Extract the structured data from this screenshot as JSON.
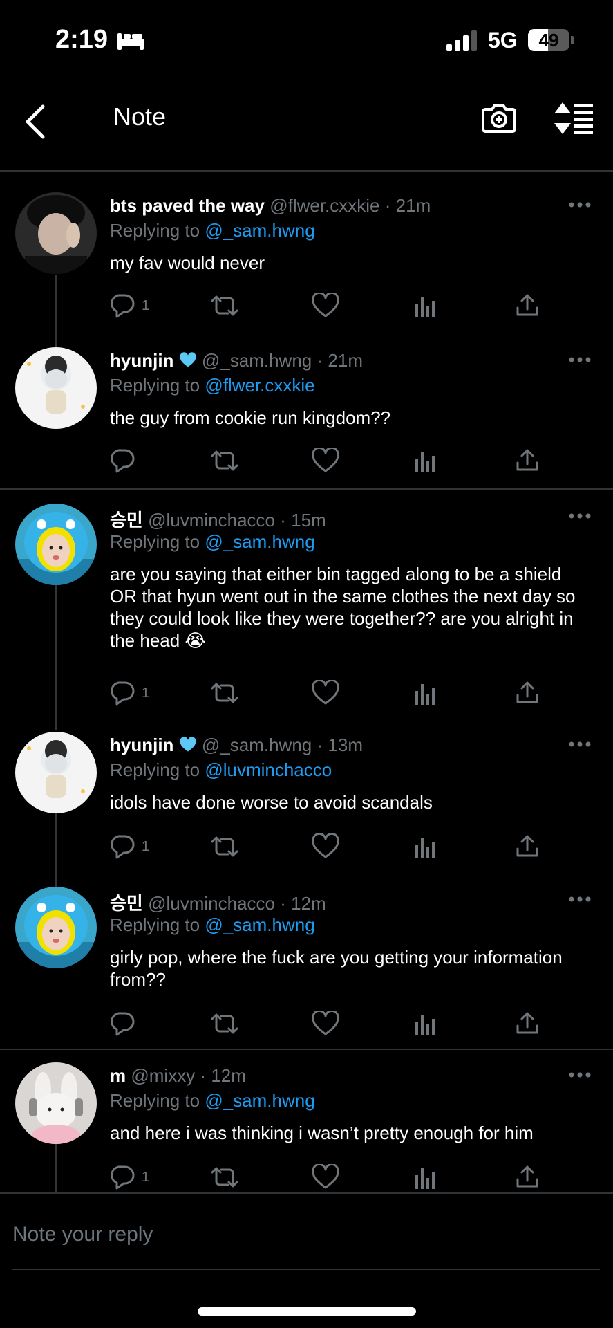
{
  "status": {
    "time": "2:19",
    "network": "5G",
    "battery": "49",
    "battery_fraction": 0.49
  },
  "nav": {
    "title": "Note"
  },
  "tweets": [
    {
      "name": "bts paved the way",
      "badge": "",
      "handle": "@flwer.cxxkie",
      "time": "21m",
      "replying_label": "Replying to",
      "replying_to": "@_sam.hwng",
      "text": "my fav would never",
      "reply_count": "1"
    },
    {
      "name": "hyunjin",
      "badge": "blue-heart",
      "handle": "@_sam.hwng",
      "time": "21m",
      "replying_label": "Replying to",
      "replying_to": "@flwer.cxxkie",
      "text": "the guy from cookie run kingdom??",
      "reply_count": ""
    },
    {
      "name": "승민",
      "badge": "",
      "handle": "@luvminchacco",
      "time": "15m",
      "replying_label": "Replying to",
      "replying_to": "@_sam.hwng",
      "text": "are you saying that either bin tagged along to be a shield OR that hyun went out in the same clothes the next day so they could look like they were together?? are you alright in the head 😭",
      "reply_count": "1"
    },
    {
      "name": "hyunjin",
      "badge": "blue-heart",
      "handle": "@_sam.hwng",
      "time": "13m",
      "replying_label": "Replying to",
      "replying_to": "@luvminchacco",
      "text": "idols have done worse to avoid scandals",
      "reply_count": "1"
    },
    {
      "name": "승민",
      "badge": "",
      "handle": "@luvminchacco",
      "time": "12m",
      "replying_label": "Replying to",
      "replying_to": "@_sam.hwng",
      "text": "girly pop, where the fuck are you getting your information from??",
      "reply_count": ""
    },
    {
      "name": "m",
      "badge": "",
      "handle": "@mixxy",
      "time": "12m",
      "replying_label": "Replying to",
      "replying_to": "@_sam.hwng",
      "text": "and here i was thinking i wasn’t pretty enough for him",
      "reply_count": "1"
    }
  ],
  "composer": {
    "placeholder": "Note your reply"
  },
  "colors": {
    "accent": "#1d9bf0",
    "muted": "#71767b",
    "background": "#000000",
    "divider": "#2f3336"
  },
  "icons": [
    "back-icon",
    "camera-plus-icon",
    "sort-icon",
    "more-icon",
    "reply-icon",
    "retweet-icon",
    "like-icon",
    "views-icon",
    "share-icon",
    "blue-heart-icon"
  ]
}
